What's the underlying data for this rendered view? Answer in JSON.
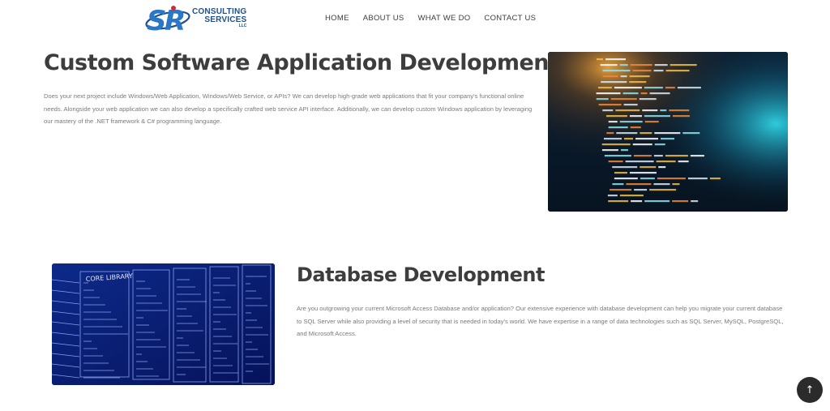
{
  "logo": {
    "line1": "CONSULTING",
    "line2": "SERVICES",
    "line3": "LLC",
    "colors": {
      "blue": "#1f4f8f",
      "red": "#d22b2b"
    }
  },
  "nav": {
    "items": [
      "HOME",
      "ABOUT US",
      "WHAT WE DO",
      "CONTACT US"
    ]
  },
  "sections": [
    {
      "title": "Custom Software Application Development",
      "body": "Does your next project include Windows/Web Application, Windows/Web Service, or APIs? We can develop high-grade web applications that fit your company's functional online needs. Alongside your web application we can also develop a specifically crafted web service API interface. Additionally, we can develop custom Windows application by leveraging our mastery of the .NET framework & C# programming language."
    },
    {
      "title": "Database Development",
      "body": "Are you outgrowing your current Microsoft Access Database and/or application? Our extensive experience with database development can help you migrate your current database to SQL Server while also providing a level of security that is needed in today's world.  We have expertise in a range of data technologies such as SQL Server, MySQL, PostgreSQL, and Microsoft Access."
    }
  ],
  "images": {
    "code_label": "CORE LIBRARY"
  },
  "scroll_top": {
    "icon": "arrow-up-icon",
    "glyph": "↑"
  }
}
